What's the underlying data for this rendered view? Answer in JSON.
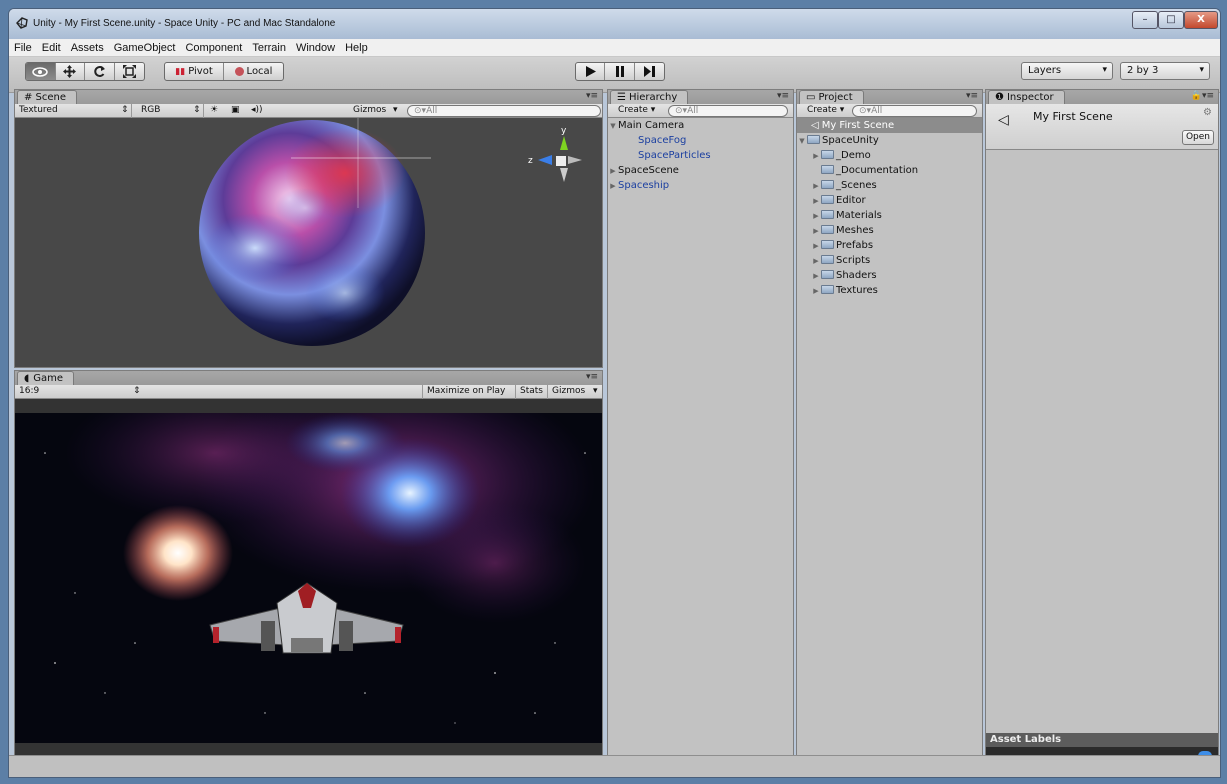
{
  "window": {
    "title": "Unity - My First Scene.unity - Space Unity - PC and Mac Standalone",
    "buttons": {
      "minimize": "–",
      "maximize": "□",
      "close": "X"
    }
  },
  "menu": [
    "File",
    "Edit",
    "Assets",
    "GameObject",
    "Component",
    "Terrain",
    "Window",
    "Help"
  ],
  "toolbar": {
    "transform_tools": [
      "view-tool",
      "move-tool",
      "rotate-tool",
      "scale-tool"
    ],
    "pivot_label": "Pivot",
    "local_label": "Local",
    "playback": [
      "play",
      "pause",
      "step"
    ],
    "layers_label": "Layers",
    "layout_label": "2 by 3"
  },
  "scene": {
    "tab": "# Scene",
    "render_mode": "Textured",
    "color_mode": "RGB",
    "gizmos": "Gizmos",
    "search_placeholder": "All",
    "axis_labels": {
      "y": "y",
      "z": "z"
    }
  },
  "game": {
    "tab": "Game",
    "aspect": "16:9",
    "maximize": "Maximize on Play",
    "stats": "Stats",
    "gizmos": "Gizmos"
  },
  "hierarchy": {
    "tab": "Hierarchy",
    "create": "Create",
    "search_placeholder": "All",
    "items": [
      {
        "label": "Main Camera",
        "arrow": "▼",
        "indent": 0,
        "blue": false
      },
      {
        "label": "SpaceFog",
        "arrow": "",
        "indent": 1,
        "blue": true
      },
      {
        "label": "SpaceParticles",
        "arrow": "",
        "indent": 1,
        "blue": true
      },
      {
        "label": "SpaceScene",
        "arrow": "▶",
        "indent": 0,
        "blue": false
      },
      {
        "label": "Spaceship",
        "arrow": "▶",
        "indent": 0,
        "blue": true
      }
    ]
  },
  "project": {
    "tab": "Project",
    "create": "Create",
    "search_placeholder": "All",
    "selected": "My First Scene",
    "root": "SpaceUnity",
    "folders": [
      {
        "label": "_Demo",
        "arrow": "▶"
      },
      {
        "label": "_Documentation",
        "arrow": ""
      },
      {
        "label": "_Scenes",
        "arrow": "▶"
      },
      {
        "label": "Editor",
        "arrow": "▶"
      },
      {
        "label": "Materials",
        "arrow": "▶"
      },
      {
        "label": "Meshes",
        "arrow": "▶"
      },
      {
        "label": "Prefabs",
        "arrow": "▶"
      },
      {
        "label": "Scripts",
        "arrow": "▶"
      },
      {
        "label": "Shaders",
        "arrow": "▶"
      },
      {
        "label": "Textures",
        "arrow": "▶"
      }
    ]
  },
  "inspector": {
    "tab": "Inspector",
    "asset_name": "My First Scene",
    "open_button": "Open",
    "asset_labels": "Asset Labels"
  }
}
